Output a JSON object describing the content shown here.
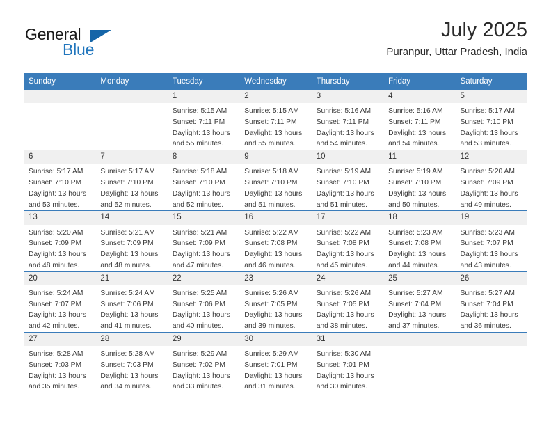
{
  "brand": {
    "name_top": "General",
    "name_bottom": "Blue",
    "triangle_color": "#1565a8",
    "blue": "#2176bd"
  },
  "header": {
    "title": "July 2025",
    "subtitle": "Puranpur, Uttar Pradesh, India"
  },
  "theme": {
    "header_bg": "#3a7cba",
    "header_text": "#ffffff",
    "daynum_bg": "#f0f0f0",
    "separator": "#3a7cba",
    "body_text": "#3a3a3a"
  },
  "weekdays": [
    "Sunday",
    "Monday",
    "Tuesday",
    "Wednesday",
    "Thursday",
    "Friday",
    "Saturday"
  ],
  "labels": {
    "sunrise_prefix": "Sunrise: ",
    "sunset_prefix": "Sunset: ",
    "daylight_prefix": "Daylight: "
  },
  "weeks": [
    [
      {
        "day": "",
        "blank": true
      },
      {
        "day": "",
        "blank": true
      },
      {
        "day": "1",
        "sunrise": "Sunrise: 5:15 AM",
        "sunset": "Sunset: 7:11 PM",
        "daylight1": "Daylight: 13 hours",
        "daylight2": "and 55 minutes."
      },
      {
        "day": "2",
        "sunrise": "Sunrise: 5:15 AM",
        "sunset": "Sunset: 7:11 PM",
        "daylight1": "Daylight: 13 hours",
        "daylight2": "and 55 minutes."
      },
      {
        "day": "3",
        "sunrise": "Sunrise: 5:16 AM",
        "sunset": "Sunset: 7:11 PM",
        "daylight1": "Daylight: 13 hours",
        "daylight2": "and 54 minutes."
      },
      {
        "day": "4",
        "sunrise": "Sunrise: 5:16 AM",
        "sunset": "Sunset: 7:11 PM",
        "daylight1": "Daylight: 13 hours",
        "daylight2": "and 54 minutes."
      },
      {
        "day": "5",
        "sunrise": "Sunrise: 5:17 AM",
        "sunset": "Sunset: 7:10 PM",
        "daylight1": "Daylight: 13 hours",
        "daylight2": "and 53 minutes."
      }
    ],
    [
      {
        "day": "6",
        "sunrise": "Sunrise: 5:17 AM",
        "sunset": "Sunset: 7:10 PM",
        "daylight1": "Daylight: 13 hours",
        "daylight2": "and 53 minutes."
      },
      {
        "day": "7",
        "sunrise": "Sunrise: 5:17 AM",
        "sunset": "Sunset: 7:10 PM",
        "daylight1": "Daylight: 13 hours",
        "daylight2": "and 52 minutes."
      },
      {
        "day": "8",
        "sunrise": "Sunrise: 5:18 AM",
        "sunset": "Sunset: 7:10 PM",
        "daylight1": "Daylight: 13 hours",
        "daylight2": "and 52 minutes."
      },
      {
        "day": "9",
        "sunrise": "Sunrise: 5:18 AM",
        "sunset": "Sunset: 7:10 PM",
        "daylight1": "Daylight: 13 hours",
        "daylight2": "and 51 minutes."
      },
      {
        "day": "10",
        "sunrise": "Sunrise: 5:19 AM",
        "sunset": "Sunset: 7:10 PM",
        "daylight1": "Daylight: 13 hours",
        "daylight2": "and 51 minutes."
      },
      {
        "day": "11",
        "sunrise": "Sunrise: 5:19 AM",
        "sunset": "Sunset: 7:10 PM",
        "daylight1": "Daylight: 13 hours",
        "daylight2": "and 50 minutes."
      },
      {
        "day": "12",
        "sunrise": "Sunrise: 5:20 AM",
        "sunset": "Sunset: 7:09 PM",
        "daylight1": "Daylight: 13 hours",
        "daylight2": "and 49 minutes."
      }
    ],
    [
      {
        "day": "13",
        "sunrise": "Sunrise: 5:20 AM",
        "sunset": "Sunset: 7:09 PM",
        "daylight1": "Daylight: 13 hours",
        "daylight2": "and 48 minutes."
      },
      {
        "day": "14",
        "sunrise": "Sunrise: 5:21 AM",
        "sunset": "Sunset: 7:09 PM",
        "daylight1": "Daylight: 13 hours",
        "daylight2": "and 48 minutes."
      },
      {
        "day": "15",
        "sunrise": "Sunrise: 5:21 AM",
        "sunset": "Sunset: 7:09 PM",
        "daylight1": "Daylight: 13 hours",
        "daylight2": "and 47 minutes."
      },
      {
        "day": "16",
        "sunrise": "Sunrise: 5:22 AM",
        "sunset": "Sunset: 7:08 PM",
        "daylight1": "Daylight: 13 hours",
        "daylight2": "and 46 minutes."
      },
      {
        "day": "17",
        "sunrise": "Sunrise: 5:22 AM",
        "sunset": "Sunset: 7:08 PM",
        "daylight1": "Daylight: 13 hours",
        "daylight2": "and 45 minutes."
      },
      {
        "day": "18",
        "sunrise": "Sunrise: 5:23 AM",
        "sunset": "Sunset: 7:08 PM",
        "daylight1": "Daylight: 13 hours",
        "daylight2": "and 44 minutes."
      },
      {
        "day": "19",
        "sunrise": "Sunrise: 5:23 AM",
        "sunset": "Sunset: 7:07 PM",
        "daylight1": "Daylight: 13 hours",
        "daylight2": "and 43 minutes."
      }
    ],
    [
      {
        "day": "20",
        "sunrise": "Sunrise: 5:24 AM",
        "sunset": "Sunset: 7:07 PM",
        "daylight1": "Daylight: 13 hours",
        "daylight2": "and 42 minutes."
      },
      {
        "day": "21",
        "sunrise": "Sunrise: 5:24 AM",
        "sunset": "Sunset: 7:06 PM",
        "daylight1": "Daylight: 13 hours",
        "daylight2": "and 41 minutes."
      },
      {
        "day": "22",
        "sunrise": "Sunrise: 5:25 AM",
        "sunset": "Sunset: 7:06 PM",
        "daylight1": "Daylight: 13 hours",
        "daylight2": "and 40 minutes."
      },
      {
        "day": "23",
        "sunrise": "Sunrise: 5:26 AM",
        "sunset": "Sunset: 7:05 PM",
        "daylight1": "Daylight: 13 hours",
        "daylight2": "and 39 minutes."
      },
      {
        "day": "24",
        "sunrise": "Sunrise: 5:26 AM",
        "sunset": "Sunset: 7:05 PM",
        "daylight1": "Daylight: 13 hours",
        "daylight2": "and 38 minutes."
      },
      {
        "day": "25",
        "sunrise": "Sunrise: 5:27 AM",
        "sunset": "Sunset: 7:04 PM",
        "daylight1": "Daylight: 13 hours",
        "daylight2": "and 37 minutes."
      },
      {
        "day": "26",
        "sunrise": "Sunrise: 5:27 AM",
        "sunset": "Sunset: 7:04 PM",
        "daylight1": "Daylight: 13 hours",
        "daylight2": "and 36 minutes."
      }
    ],
    [
      {
        "day": "27",
        "sunrise": "Sunrise: 5:28 AM",
        "sunset": "Sunset: 7:03 PM",
        "daylight1": "Daylight: 13 hours",
        "daylight2": "and 35 minutes."
      },
      {
        "day": "28",
        "sunrise": "Sunrise: 5:28 AM",
        "sunset": "Sunset: 7:03 PM",
        "daylight1": "Daylight: 13 hours",
        "daylight2": "and 34 minutes."
      },
      {
        "day": "29",
        "sunrise": "Sunrise: 5:29 AM",
        "sunset": "Sunset: 7:02 PM",
        "daylight1": "Daylight: 13 hours",
        "daylight2": "and 33 minutes."
      },
      {
        "day": "30",
        "sunrise": "Sunrise: 5:29 AM",
        "sunset": "Sunset: 7:01 PM",
        "daylight1": "Daylight: 13 hours",
        "daylight2": "and 31 minutes."
      },
      {
        "day": "31",
        "sunrise": "Sunrise: 5:30 AM",
        "sunset": "Sunset: 7:01 PM",
        "daylight1": "Daylight: 13 hours",
        "daylight2": "and 30 minutes."
      },
      {
        "day": "",
        "blank": true
      },
      {
        "day": "",
        "blank": true
      }
    ]
  ]
}
